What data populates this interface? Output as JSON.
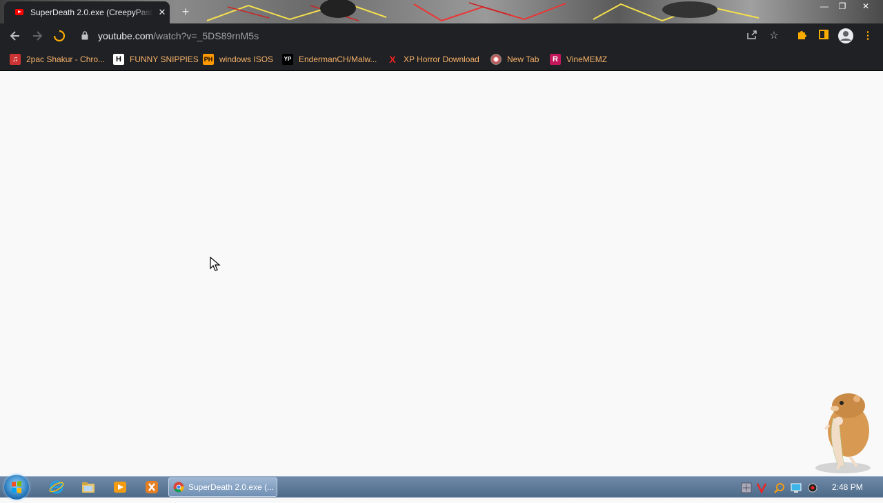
{
  "tab": {
    "title": "SuperDeath 2.0.exe (CreepyPasta",
    "close": "✕",
    "new": "+"
  },
  "window": {
    "min": "—",
    "max": "❐",
    "close": "✕"
  },
  "toolbar": {
    "url_host": "youtube.com",
    "url_path": "/watch?v=_5DS89rnM5s"
  },
  "bookmarks": [
    {
      "label": "2pac Shakur - Chro...",
      "icon": "H"
    },
    {
      "label": "FUNNY SNIPPIES",
      "icon": "H"
    },
    {
      "label": "windows ISOS",
      "icon": "PH"
    },
    {
      "label": "EndermanCH/Malw...",
      "icon": "YP"
    },
    {
      "label": "XP Horror Download",
      "icon": "X"
    },
    {
      "label": "New Tab",
      "icon": ""
    },
    {
      "label": "VineMEMZ",
      "icon": "R"
    }
  ],
  "taskbar": {
    "active_task": "SuperDeath 2.0.exe (...",
    "clock": "2:48 PM"
  },
  "colors": {
    "bookmark_text": "#f6b26b",
    "chrome_bg": "#202124",
    "accent_yellow": "#f9ab00"
  }
}
